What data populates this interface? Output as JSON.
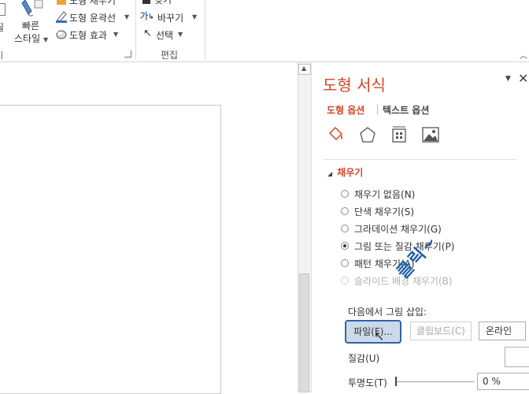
{
  "ribbon": {
    "left_partial": {
      "label_top": "질",
      "label_group": "기"
    },
    "quick_style": {
      "label_line1": "빠른",
      "label_line2": "스타일"
    },
    "shape_commands": [
      {
        "label": "도형 채우기",
        "icon": "paint-bucket-icon"
      },
      {
        "label": "도형 윤곽선",
        "icon": "pen-outline-icon"
      },
      {
        "label": "도형 효과",
        "icon": "shape-effects-icon"
      }
    ],
    "edit_commands": [
      {
        "label": "찾기",
        "icon": "find-icon"
      },
      {
        "label": "바꾸기",
        "icon": "replace-icon"
      },
      {
        "label": "선택",
        "icon": "select-cursor-icon"
      }
    ],
    "edit_group_label": "편집",
    "collapse_icon": "chevron-up-icon"
  },
  "pane": {
    "title": "도형 서식",
    "tabs": [
      {
        "label": "도형 옵션",
        "active": true
      },
      {
        "label": "텍스트 옵션",
        "active": false
      }
    ],
    "section_title": "채우기",
    "fill_options": [
      {
        "label": "채우기 없음(N)",
        "checked": false,
        "disabled": false
      },
      {
        "label": "단색 채우기(S)",
        "checked": false,
        "disabled": false
      },
      {
        "label": "그라데이션 채우기(G)",
        "checked": false,
        "disabled": false
      },
      {
        "label": "그림 또는 질감 채우기(P)",
        "checked": true,
        "disabled": false
      },
      {
        "label": "패턴 채우기(A)",
        "checked": false,
        "disabled": false
      },
      {
        "label": "슬라이드 배경 채우기(B)",
        "checked": false,
        "disabled": true
      }
    ],
    "insert_from_label": "다음에서 그림 삽입:",
    "buttons": {
      "file": "파일(F)...",
      "clipboard": "클립보드(C)",
      "online": "온라인"
    },
    "texture_label": "질감(U)",
    "transparency_label": "투명도(T)",
    "transparency_value": "0 %",
    "transparency": 0,
    "annotation": "클릭~"
  },
  "colors": {
    "accent": "#d24726",
    "annotation": "#1f5fa8",
    "selected_button": "#2f64a8"
  }
}
